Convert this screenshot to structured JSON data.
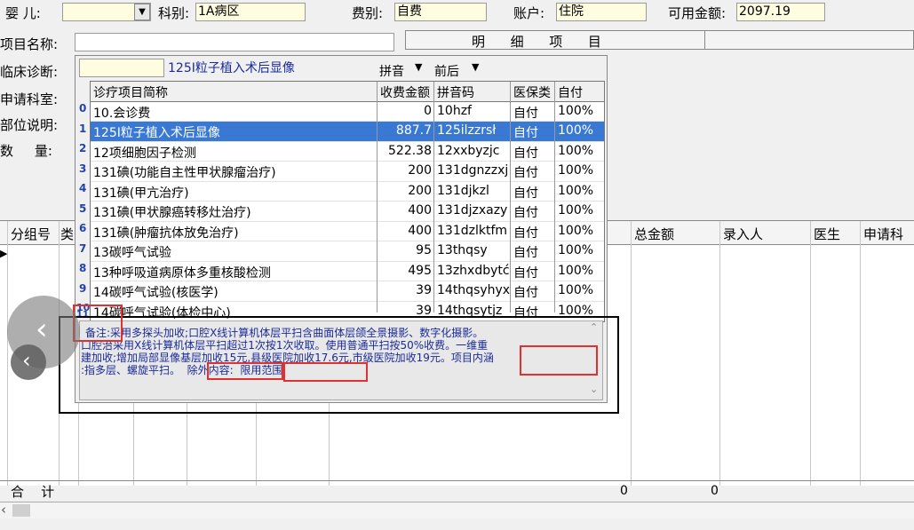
{
  "top_form": {
    "infant_label": "婴  儿:",
    "dept_label": "科别:",
    "dept_value": "1A病区",
    "fee_label": "费别:",
    "fee_value": "自费",
    "account_label": "账户:",
    "account_value": "住院",
    "balance_label": "可用金额:",
    "balance_value": "2097.19",
    "item_name_label": "项目名称:",
    "diagnosis_label": "临床诊断:",
    "apply_dept_label": "申请科室:",
    "part_label": "部位说明:",
    "qty_label": "数     量:",
    "detail_header": "明      细      项      目"
  },
  "popup": {
    "search_value": "",
    "selected_name": "125I粒子植入术后显像",
    "pinyin_label": "拼音",
    "order_label": "前后",
    "columns": [
      "诊疗项目简称",
      "收费金额",
      "拼音码",
      "医保类",
      "自付"
    ],
    "rows": [
      {
        "idx": "0",
        "name": "10.会诊费",
        "amount": "0",
        "code": "10hzf",
        "ins": "自付",
        "pay": "100%"
      },
      {
        "idx": "1",
        "name": "125I粒子植入术后显像",
        "amount": "887.7",
        "code": "125ilzzrsł",
        "ins": "自付",
        "pay": "100%"
      },
      {
        "idx": "2",
        "name": "12项细胞因子检测",
        "amount": "522.38",
        "code": "12xxbyzjc",
        "ins": "自付",
        "pay": "100%"
      },
      {
        "idx": "3",
        "name": "131碘(功能自主性甲状腺瘤治疗)",
        "amount": "200",
        "code": "131dgnzzxj",
        "ins": "自付",
        "pay": "100%"
      },
      {
        "idx": "4",
        "name": "131碘(甲亢治疗)",
        "amount": "200",
        "code": "131djkzl",
        "ins": "自付",
        "pay": "100%"
      },
      {
        "idx": "5",
        "name": "131碘(甲状腺癌转移灶治疗)",
        "amount": "400",
        "code": "131djzxazy",
        "ins": "自付",
        "pay": "100%"
      },
      {
        "idx": "6",
        "name": "131碘(肿瘤抗体放免治疗)",
        "amount": "400",
        "code": "131dzlktfm",
        "ins": "自付",
        "pay": "100%"
      },
      {
        "idx": "7",
        "name": "13碳呼气试验",
        "amount": "95",
        "code": "13thqsy",
        "ins": "自付",
        "pay": "100%"
      },
      {
        "idx": "8",
        "name": "13种呼吸道病原体多重核酸检测",
        "amount": "495",
        "code": "13zhxdbytć",
        "ins": "自付",
        "pay": "100%"
      },
      {
        "idx": "9",
        "name": "14碳呼气试验(核医学)",
        "amount": "39",
        "code": "14thqsyhyx",
        "ins": "自付",
        "pay": "100%"
      },
      {
        "idx": "10",
        "name": "14碳呼气试验(体检中心)",
        "amount": "39",
        "code": "14thqsytjz",
        "ins": "自付",
        "pay": "100%"
      }
    ],
    "next_idx": "11",
    "remark_line1": "备注:采用多探头加收;口腔X线计算机体层平扫含曲面体层颌全景摄影、数字化摄影。",
    "remark_line2": "口腔治采用X线计算机体层平扫超过1次按1次收取。使用普通平扫按50%收费。一维重",
    "remark_line3": "建加收;增加局部显像基层加收15元,县级医院加收17.6元,市级医院加收19元。项目内涵",
    "remark_line4": ":指多层、螺旋平扫。  除外内容:  限用范围:"
  },
  "grid": {
    "headers": [
      "分组号",
      "类",
      "总金额",
      "录入人",
      "医生",
      "申请科"
    ],
    "total_label": "合    计",
    "total_amount": "0",
    "total_count": "0"
  }
}
